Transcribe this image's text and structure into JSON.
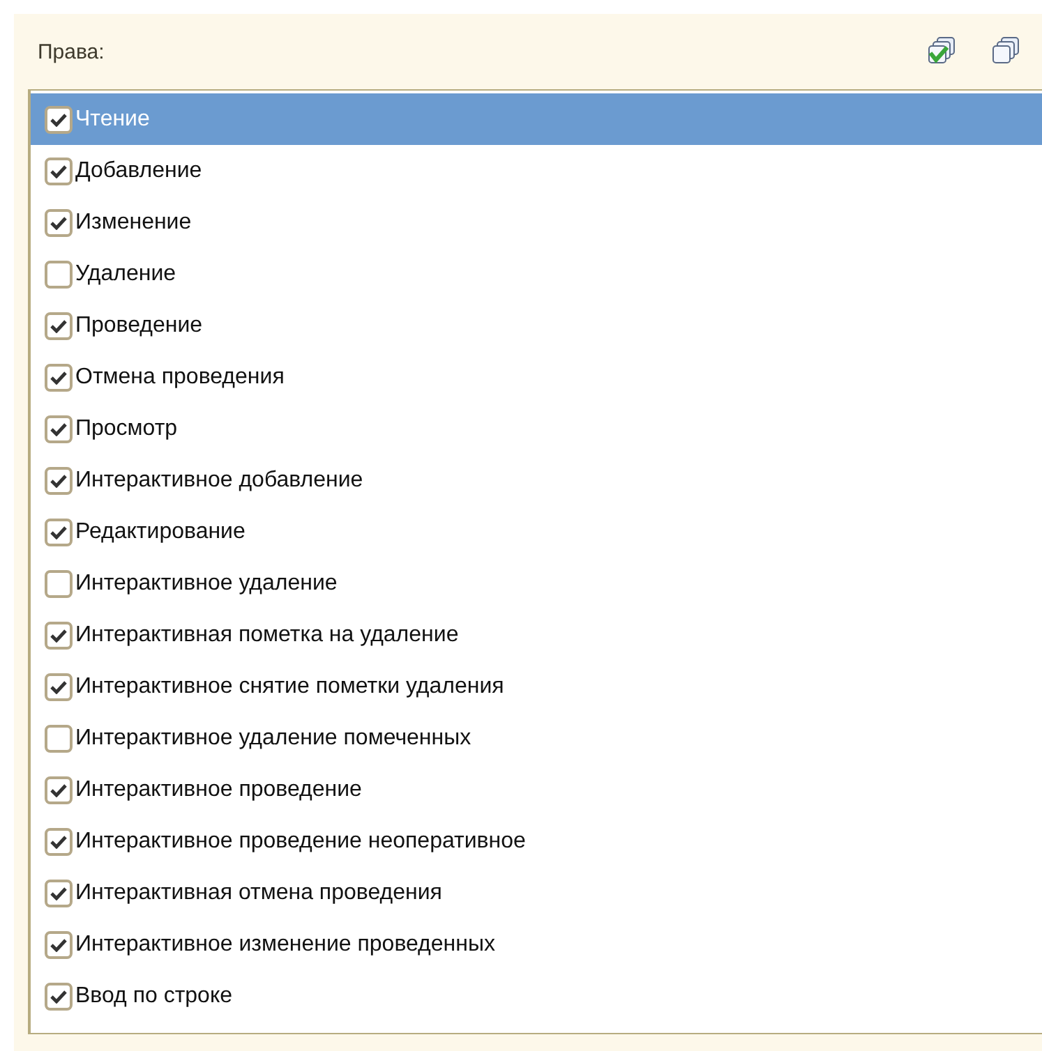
{
  "panel": {
    "title": "Права:"
  },
  "rights": [
    {
      "label": "Чтение",
      "checked": true,
      "selected": true
    },
    {
      "label": "Добавление",
      "checked": true,
      "selected": false
    },
    {
      "label": "Изменение",
      "checked": true,
      "selected": false
    },
    {
      "label": "Удаление",
      "checked": false,
      "selected": false
    },
    {
      "label": "Проведение",
      "checked": true,
      "selected": false
    },
    {
      "label": "Отмена проведения",
      "checked": true,
      "selected": false
    },
    {
      "label": "Просмотр",
      "checked": true,
      "selected": false
    },
    {
      "label": "Интерактивное добавление",
      "checked": true,
      "selected": false
    },
    {
      "label": "Редактирование",
      "checked": true,
      "selected": false
    },
    {
      "label": "Интерактивное удаление",
      "checked": false,
      "selected": false
    },
    {
      "label": "Интерактивная пометка на удаление",
      "checked": true,
      "selected": false
    },
    {
      "label": "Интерактивное снятие пометки удаления",
      "checked": true,
      "selected": false
    },
    {
      "label": "Интерактивное удаление помеченных",
      "checked": false,
      "selected": false
    },
    {
      "label": "Интерактивное проведение",
      "checked": true,
      "selected": false
    },
    {
      "label": "Интерактивное проведение неоперативное",
      "checked": true,
      "selected": false
    },
    {
      "label": "Интерактивная отмена проведения",
      "checked": true,
      "selected": false
    },
    {
      "label": "Интерактивное изменение проведенных",
      "checked": true,
      "selected": false
    },
    {
      "label": "Ввод по строке",
      "checked": true,
      "selected": false
    }
  ]
}
